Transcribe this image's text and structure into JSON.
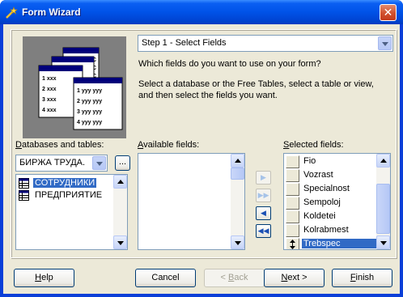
{
  "window": {
    "title": "Form Wizard",
    "close_glyph": "✕"
  },
  "step_combo": {
    "value": "Step 1 - Select Fields"
  },
  "prompt": "Which fields do you want to use on your form?",
  "instructions": [
    "Select a database or the Free Tables, select a table or view,",
    "and then select the fields you want."
  ],
  "illustration": {
    "front_rows": [
      "1 yyy yyy",
      "2 yyy yyy",
      "3 yyy yyy",
      "4 yyy yyy"
    ],
    "back_rows": [
      "1  xxx",
      "2  xxx",
      "3  xxx",
      "4  xxx"
    ],
    "rear_letters": [
      "C",
      "C",
      "C",
      "C"
    ]
  },
  "databases_label": {
    "pre": "",
    "key": "D",
    "post": "atabases and tables:"
  },
  "database_combo": {
    "value": "БИРЖА ТРУДА."
  },
  "browse_label": "...",
  "tables": [
    {
      "label": "СОТРУДНИКИ",
      "selected": true,
      "icon": "table-icon"
    },
    {
      "label": "ПРЕДПРИЯТИЕ",
      "selected": false,
      "icon": "table-icon"
    }
  ],
  "available_label": {
    "pre": "",
    "key": "A",
    "post": "vailable fields:"
  },
  "available_fields": [],
  "selected_label": {
    "pre": "",
    "key": "S",
    "post": "elected fields:"
  },
  "selected_fields": [
    {
      "label": "Fio",
      "selected": false
    },
    {
      "label": "Vozrast",
      "selected": false
    },
    {
      "label": "Specialnost",
      "selected": false
    },
    {
      "label": "Sempoloj",
      "selected": false
    },
    {
      "label": "Koldetei",
      "selected": false
    },
    {
      "label": "Kolrabmest",
      "selected": false
    },
    {
      "label": "Trebspec",
      "selected": true
    }
  ],
  "move_buttons": [
    {
      "glyph": "▶",
      "enabled": false
    },
    {
      "glyph": "▶▶",
      "enabled": false
    },
    {
      "glyph": "◀",
      "enabled": true
    },
    {
      "glyph": "◀◀",
      "enabled": true
    }
  ],
  "buttons": {
    "help": {
      "pre": "",
      "key": "H",
      "post": "elp"
    },
    "cancel": {
      "label": "Cancel"
    },
    "back": {
      "pre": "< ",
      "key": "B",
      "post": "ack"
    },
    "next": {
      "pre": "",
      "key": "N",
      "post": "ext >"
    },
    "finish": {
      "pre": "",
      "key": "F",
      "post": "inish"
    }
  },
  "colors": {
    "title_bar": "#0053e8",
    "selection": "#316ac5",
    "dialog_face": "#ece9d8"
  }
}
